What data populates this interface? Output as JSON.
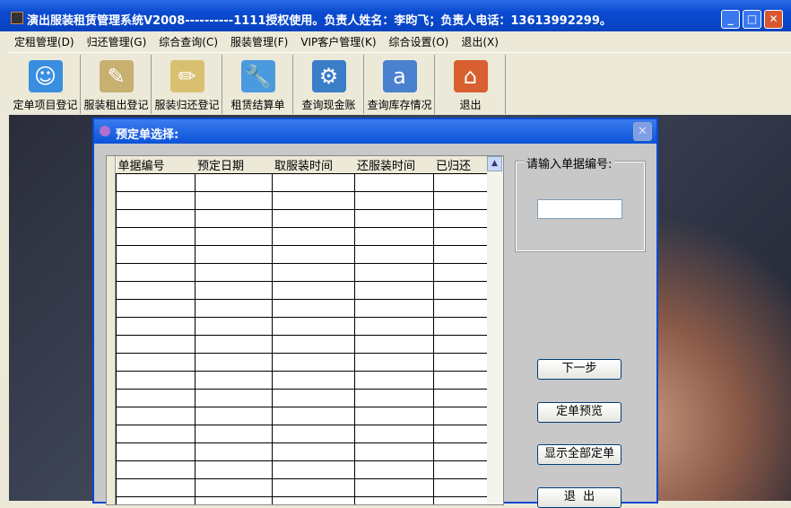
{
  "window": {
    "title": "演出服装租赁管理系统V2008----------1111授权使用。负责人姓名：李昀飞；负责人电话：13613992299。"
  },
  "menu": [
    "定租管理(D)",
    "归还管理(G)",
    "综合查询(C)",
    "服装管理(F)",
    "VIP客户管理(K)",
    "综合设置(O)",
    "退出(X)"
  ],
  "toolbar": [
    {
      "label": "定单项目登记",
      "icon": "finder-folder-icon",
      "color": "#3a8ee0"
    },
    {
      "label": "服装租出登记",
      "icon": "document-pen-icon",
      "color": "#c8b070"
    },
    {
      "label": "服装归还登记",
      "icon": "document-pencil-icon",
      "color": "#d8c070"
    },
    {
      "label": "租赁结算单",
      "icon": "wrench-folder-icon",
      "color": "#4a9ae0"
    },
    {
      "label": "查询现金账",
      "icon": "gear-folder-icon",
      "color": "#3a7ec8"
    },
    {
      "label": "查询库存情况",
      "icon": "address-book-icon",
      "color": "#4a80d0"
    },
    {
      "label": "退出",
      "icon": "home-icon",
      "color": "#d86030"
    }
  ],
  "dialog": {
    "title": "预定单选择:",
    "columns": [
      "单据编号",
      "预定日期",
      "取服装时间",
      "还服装时间",
      "已归还"
    ],
    "group_label": "请输入单据编号:",
    "input_value": "",
    "buttons": {
      "next": "下一步",
      "preview": "定单预览",
      "show_all": "显示全部定单",
      "exit": "退  出"
    }
  }
}
